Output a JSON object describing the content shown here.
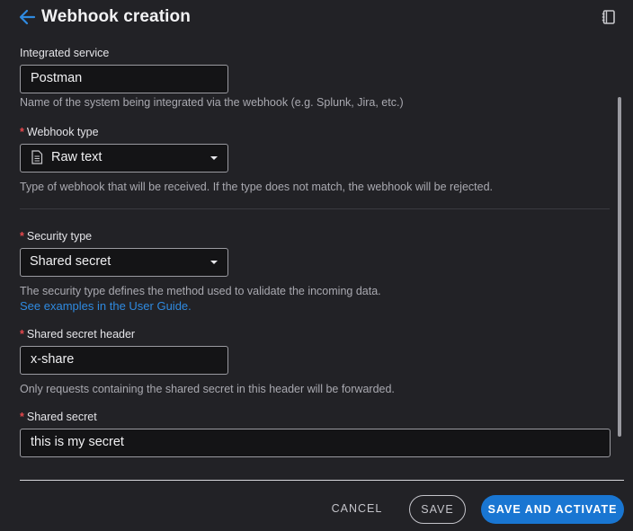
{
  "header": {
    "title": "Webhook creation"
  },
  "form": {
    "integrated_service": {
      "label": "Integrated service",
      "value": "Postman",
      "help": "Name of the system being integrated via the webhook (e.g. Splunk, Jira, etc.)"
    },
    "webhook_type": {
      "required_mark": "*",
      "label": "Webhook type",
      "value": "Raw text",
      "help": "Type of webhook that will be received. If the type does not match, the webhook will be rejected."
    },
    "security_type": {
      "required_mark": "*",
      "label": "Security type",
      "value": "Shared secret",
      "help": "The security type defines the method used to validate the incoming data.",
      "link": "See examples in the User Guide."
    },
    "shared_secret_header": {
      "required_mark": "*",
      "label": "Shared secret header",
      "value": "x-share",
      "help": "Only requests containing the shared secret in this header will be forwarded."
    },
    "shared_secret": {
      "required_mark": "*",
      "label": "Shared secret",
      "value": "this is my secret"
    }
  },
  "footer": {
    "cancel_label": "CANCEL",
    "save_label": "SAVE",
    "save_activate_label": "SAVE AND ACTIVATE"
  },
  "colors": {
    "background": "#222226",
    "accent": "#1976d2",
    "link": "#2f8ae0",
    "required": "#e5484d"
  },
  "icons": [
    "arrow-left-icon",
    "book-icon",
    "document-icon",
    "caret-down-icon"
  ]
}
